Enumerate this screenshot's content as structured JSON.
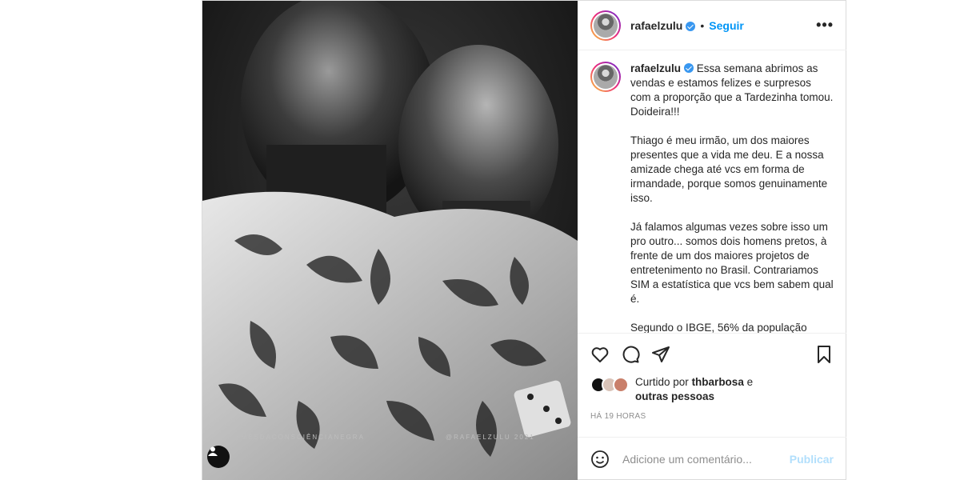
{
  "post": {
    "username": "rafaelzulu",
    "follow_label": "Seguir",
    "separator": "•",
    "more_label": "•••"
  },
  "photo": {
    "watermark_left": "#MÊSDACONSCIÊNCIANEGRA",
    "watermark_right": "@RAFAELZULU 2021"
  },
  "caption": {
    "username": "rafaelzulu",
    "paragraphs": [
      "Essa semana abrimos as vendas e estamos felizes e surpresos com a proporção que a Tardezinha tomou. Doideira!!!",
      "Thiago é meu irmão, um dos maiores presentes que a vida me deu. E a nossa amizade chega até vcs em forma de irmandade, porque somos genuinamente isso.",
      "Já falamos algumas vezes sobre isso um pro outro... somos dois homens pretos, à frente de um dos maiores projetos de entretenimento no Brasil. Contrariamos SIM a estatística que vcs bem sabem qual é.",
      "Segundo o IBGE, 56% da população"
    ]
  },
  "likes": {
    "prefix": "Curtido por",
    "user": "thbarbosa",
    "conj": "e",
    "others": "outras pessoas"
  },
  "timestamp": "HÁ 19 HORAS",
  "comment": {
    "placeholder": "Adicione um comentário...",
    "publish_label": "Publicar"
  },
  "colors": {
    "accent": "#0095f6",
    "publish_disabled": "#b2dffc",
    "verified": "#3897f0"
  }
}
